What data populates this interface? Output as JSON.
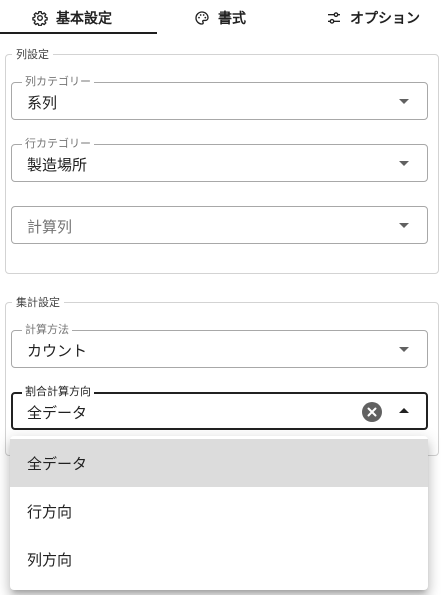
{
  "tabs": [
    {
      "label": "基本設定",
      "icon": "gear-icon",
      "active": true
    },
    {
      "label": "書式",
      "icon": "palette-icon",
      "active": false
    },
    {
      "label": "オプション",
      "icon": "tune-icon",
      "active": false
    }
  ],
  "column_settings": {
    "title": "列設定",
    "column_category": {
      "label": "列カテゴリー",
      "value": "系列"
    },
    "row_category": {
      "label": "行カテゴリー",
      "value": "製造場所"
    },
    "calc_column": {
      "placeholder": "計算列"
    }
  },
  "aggregate_settings": {
    "title": "集計設定",
    "calc_method": {
      "label": "計算方法",
      "value": "カウント"
    },
    "ratio_direction": {
      "label": "割合計算方向",
      "value": "全データ"
    }
  },
  "dropdown": {
    "options": [
      {
        "label": "全データ",
        "selected": true
      },
      {
        "label": "行方向",
        "selected": false
      },
      {
        "label": "列方向",
        "selected": false
      }
    ]
  }
}
